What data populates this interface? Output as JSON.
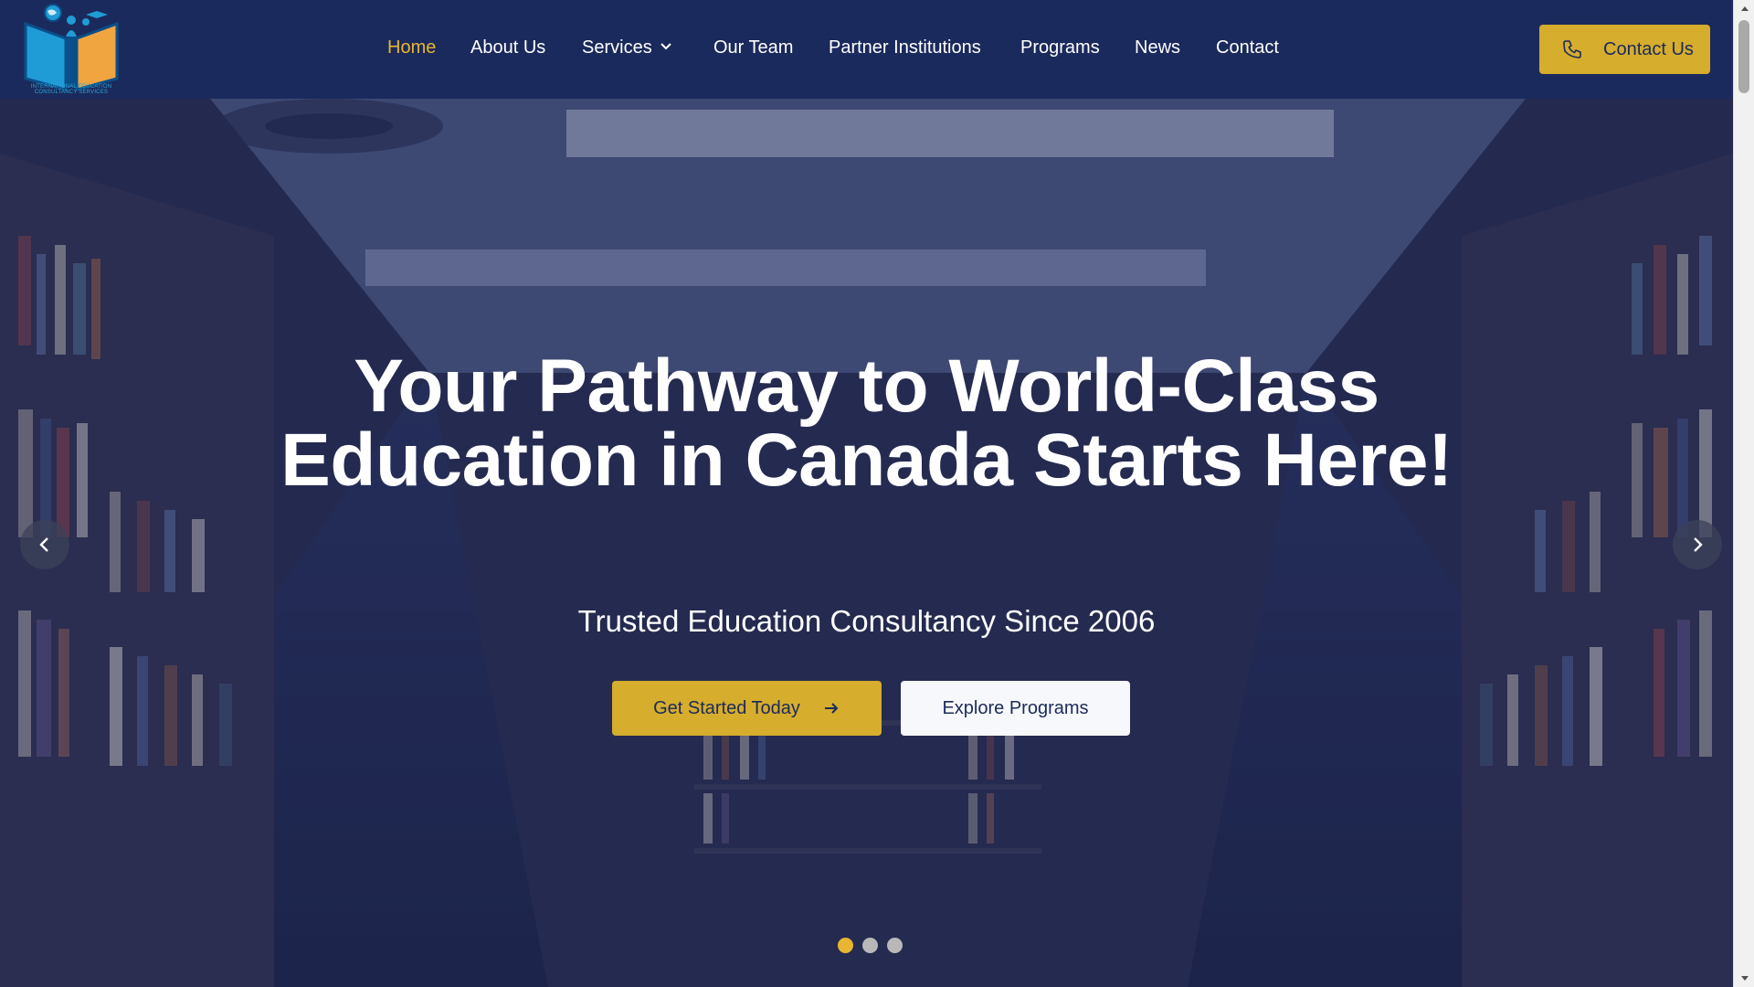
{
  "brand": {
    "logo_icon": "open-book-globe-logo",
    "logo_text": "INTERNATIONAL EDUCATION CONSULTANCY SERVICES"
  },
  "nav": {
    "items": [
      {
        "label": "Home",
        "active": true
      },
      {
        "label": "About Us"
      },
      {
        "label": "Services",
        "has_dropdown": true
      },
      {
        "label": "Our Team"
      },
      {
        "label": "Partner Institutions"
      },
      {
        "label": "Programs"
      },
      {
        "label": "News"
      },
      {
        "label": "Contact"
      }
    ],
    "cta_label": "Contact Us",
    "cta_icon": "phone-icon"
  },
  "hero": {
    "title": "Your Pathway to World-Class Education in Canada Starts Here!",
    "subtitle": "Trusted Education Consultancy Since 2006",
    "primary_button": "Get Started Today",
    "secondary_button": "Explore Programs",
    "slide_count": 3,
    "active_slide": 1
  },
  "colors": {
    "nav_bg": "#1b2a5c",
    "accent": "#d6ad2c",
    "active_nav": "#e8b532",
    "text_light": "#ffffff"
  }
}
